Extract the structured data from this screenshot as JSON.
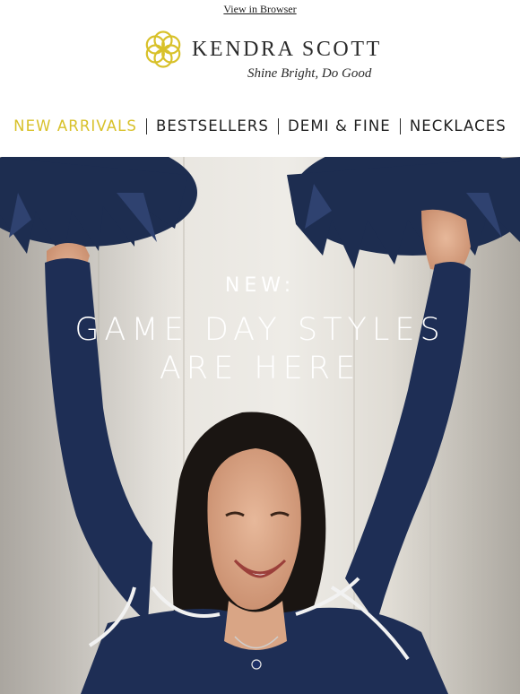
{
  "header": {
    "view_in_browser": "View in Browser"
  },
  "brand": {
    "name": "KENDRA SCOTT",
    "tagline": "Shine Bright, Do Good",
    "logo_icon": "kendra-scott-flower-logo",
    "accent_color": "#d8c12a"
  },
  "nav": {
    "items": [
      {
        "label": "NEW ARRIVALS"
      },
      {
        "label": "BESTSELLERS"
      },
      {
        "label": "DEMI & FINE"
      },
      {
        "label": "NECKLACES"
      }
    ]
  },
  "hero": {
    "kicker": "NEW:",
    "title_line1": "GAME DAY STYLES",
    "title_line2": "ARE HERE",
    "image_subject": "woman cheering with navy pom-poms in navy sweater"
  }
}
